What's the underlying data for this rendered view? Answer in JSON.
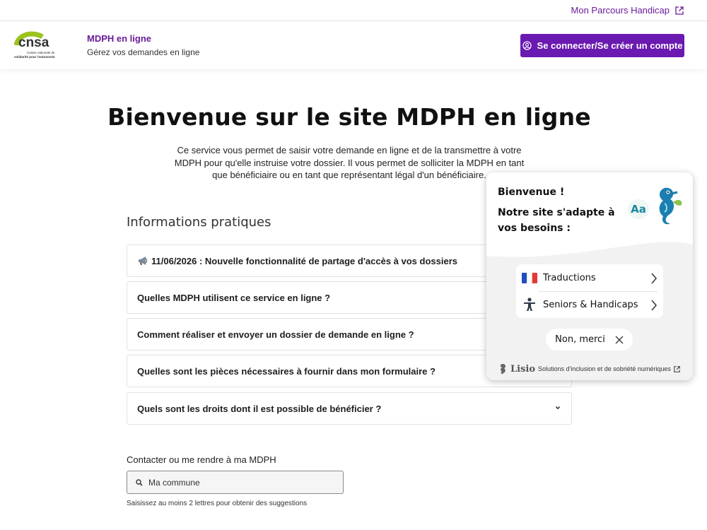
{
  "topbar": {
    "link_label": "Mon Parcours Handicap"
  },
  "header": {
    "logo_text": "cnsa",
    "logo_caption_line1": "Caisse nationale de",
    "logo_caption_line2": "solidarité pour l'autonomie",
    "site_title": "MDPH en ligne",
    "site_subtitle": "Gérez vos demandes en ligne",
    "login_label": "Se connecter/Se créer un compte"
  },
  "main": {
    "title": "Bienvenue sur le site MDPH en ligne",
    "intro": "Ce service vous permet de saisir votre demande en ligne et de la transmettre à votre MDPH pour qu'elle instruise votre dossier. Il vous permet de solliciter la MDPH en tant que bénéficiaire ou en tant que représentant légal d'un bénéficiaire."
  },
  "info": {
    "title": "Informations pratiques",
    "items": [
      {
        "label": "11/06/2026 : Nouvelle fonctionnalité de partage d'accès à vos dossiers"
      },
      {
        "label": "Quelles MDPH utilisent ce service en ligne ?"
      },
      {
        "label": "Comment réaliser et envoyer un dossier de demande en ligne ?"
      },
      {
        "label": "Quelles sont les pièces nécessaires à fournir dans mon formulaire ?"
      },
      {
        "label": "Quels sont les droits dont il est possible de bénéficier ?"
      }
    ]
  },
  "contact": {
    "label": "Contacter ou me rendre à ma MDPH",
    "placeholder": "Ma commune",
    "hint": "Saisissez au moins 2 lettres pour obtenir des suggestions"
  },
  "lisio": {
    "welcome": "Bienvenue !",
    "adapt": "Notre site s'adapte à vos besoins :",
    "mascot_text": "Aa",
    "options": [
      {
        "label": "Traductions",
        "icon": "french-flag-icon"
      },
      {
        "label": "Seniors & Handicaps",
        "icon": "accessibility-person-icon"
      }
    ],
    "decline_label": "Non, merci",
    "brand": "Lisio",
    "footer_text": "Solutions d'inclusion et de sobriété numériques"
  },
  "colors": {
    "brand": "#6a1ab0",
    "link": "#6a1b9a",
    "logo_green": "#9bc31c"
  }
}
